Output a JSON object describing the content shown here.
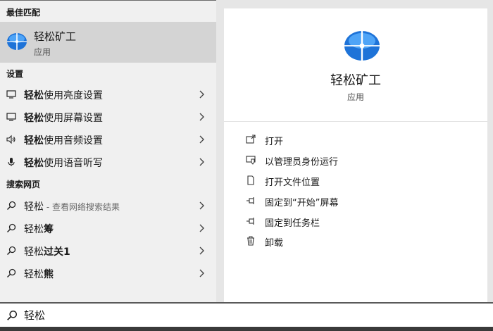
{
  "best_match": {
    "section_label": "最佳匹配",
    "title": "轻松矿工",
    "subtitle": "应用",
    "icon": "blue-globe-app-icon"
  },
  "settings": {
    "section_label": "设置",
    "items": [
      {
        "bold": "轻松",
        "rest": "使用亮度设置",
        "icon": "monitor-icon"
      },
      {
        "bold": "轻松",
        "rest": "使用屏幕设置",
        "icon": "monitor-icon"
      },
      {
        "bold": "轻松",
        "rest": "使用音频设置",
        "icon": "speaker-icon"
      },
      {
        "bold": "轻松",
        "rest": "使用语音听写",
        "icon": "microphone-icon"
      }
    ]
  },
  "web_search": {
    "section_label": "搜索网页",
    "items": [
      {
        "main": "轻松",
        "bold": "",
        "muted": " - 查看网络搜索结果"
      },
      {
        "main": "轻松",
        "bold": "筹",
        "muted": ""
      },
      {
        "main": "轻松",
        "bold": "过关1",
        "muted": ""
      },
      {
        "main": "轻松",
        "bold": "熊",
        "muted": ""
      }
    ]
  },
  "detail": {
    "app_name": "轻松矿工",
    "app_type": "应用",
    "actions": [
      {
        "label": "打开",
        "icon": "open-window-icon"
      },
      {
        "label": "以管理员身份运行",
        "icon": "shield-icon"
      },
      {
        "label": "打开文件位置",
        "icon": "file-location-icon"
      },
      {
        "label": "固定到“开始”屏幕",
        "icon": "pin-icon"
      },
      {
        "label": "固定到任务栏",
        "icon": "pin-icon"
      },
      {
        "label": "卸载",
        "icon": "trash-icon"
      }
    ]
  },
  "search": {
    "value": "轻松"
  },
  "colors": {
    "accent_blue": "#1e73d8",
    "left_bg": "#f0f0f0",
    "selected_bg": "#d4d4d4"
  }
}
